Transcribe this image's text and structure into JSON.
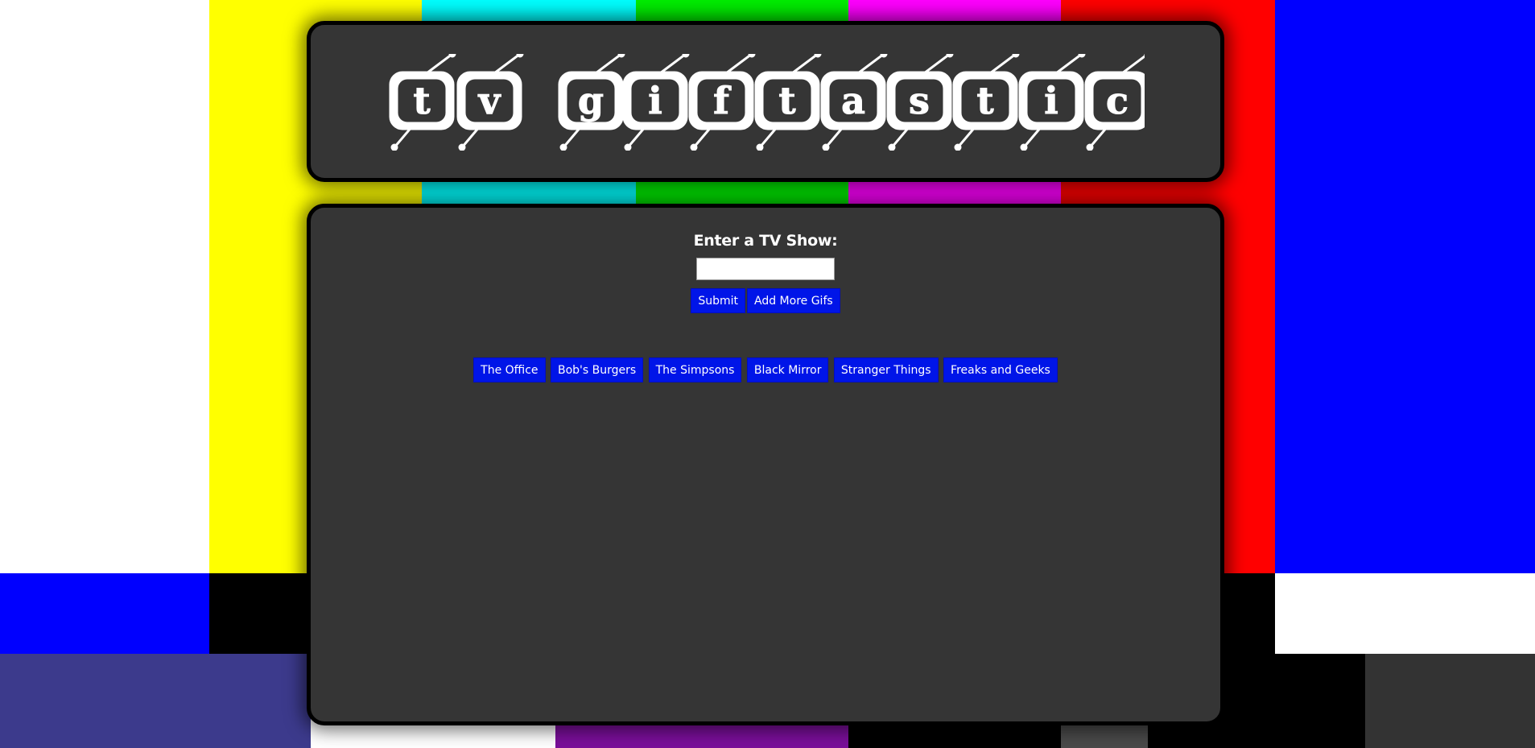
{
  "page": {
    "title": "tv giftastic"
  },
  "logo": {
    "text": "tv giftastic",
    "letters": [
      "t",
      "v",
      "",
      "g",
      "i",
      "f",
      "t",
      "a",
      "s",
      "t",
      "i",
      "c"
    ]
  },
  "colors": {
    "panel": "#353535",
    "button": "#0015e8",
    "button_text": "#ffffff",
    "bars": [
      "#ffffff",
      "#ffff00",
      "#00ffff",
      "#00ff00",
      "#ff00ff",
      "#ff0000",
      "#0000ff"
    ]
  },
  "form": {
    "label": "Enter a TV Show:",
    "input_value": "",
    "input_placeholder": "",
    "submit_label": "Submit",
    "add_more_label": "Add More Gifs"
  },
  "shows": [
    {
      "label": "The Office"
    },
    {
      "label": "Bob's Burgers"
    },
    {
      "label": "The Simpsons"
    },
    {
      "label": "Black Mirror"
    },
    {
      "label": "Stranger Things"
    },
    {
      "label": "Freaks and Geeks"
    }
  ]
}
